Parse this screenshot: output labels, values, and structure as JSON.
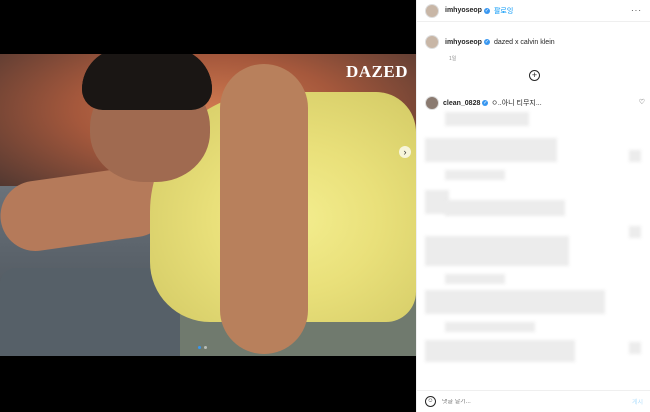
{
  "post": {
    "media": {
      "logo_text": "DAZED",
      "next_icon": "chevron-right-icon",
      "carousel_dots": 2,
      "active_dot": 1
    },
    "header": {
      "username": "imhyoseop",
      "follow_label": "팔로잉",
      "more_label": "···"
    },
    "caption": {
      "username": "imhyoseop",
      "text": "dazed x calvin klein",
      "time": "1일"
    },
    "load_more_icon": "plus-circle-icon",
    "comments": [
      {
        "username": "clean_0828",
        "text": "ㅇ..아니 티무지..."
      }
    ],
    "footer": {
      "placeholder": "댓글 달기...",
      "post_label": "게시"
    }
  },
  "colors": {
    "accent": "#0095f6",
    "verified": "#3897f0",
    "text": "#262626",
    "muted": "#8e8e8e"
  }
}
